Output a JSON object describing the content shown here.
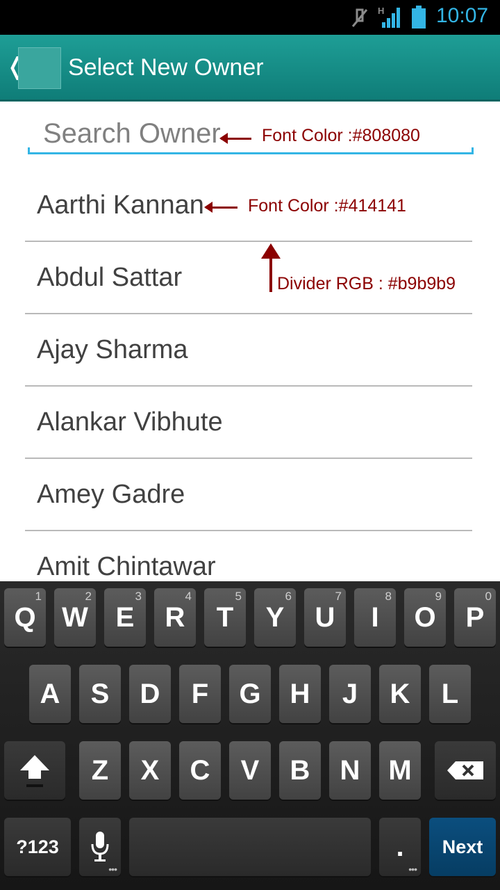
{
  "status_bar": {
    "time": "10:07",
    "network_type": "H"
  },
  "action_bar": {
    "title": "Select New Owner",
    "back_glyph": "❬"
  },
  "search": {
    "placeholder": "Search Owner",
    "value": ""
  },
  "owners": [
    "Aarthi Kannan",
    "Abdul Sattar",
    "Ajay Sharma",
    "Alankar Vibhute",
    "Amey Gadre",
    "Amit Chintawar"
  ],
  "annotations": {
    "search_font": "Font Color :#808080",
    "item_font": "Font Color :#414141",
    "divider": "Divider RGB : #b9b9b9"
  },
  "colors": {
    "action_bar": "#1e9e96",
    "search_underline": "#33b5e5",
    "placeholder": "#808080",
    "item_text": "#414141",
    "divider": "#b9b9b9",
    "annotation": "#8b0000",
    "next_key": "#0b4e7e"
  },
  "keyboard": {
    "row1": [
      {
        "label": "Q",
        "hint": "1"
      },
      {
        "label": "W",
        "hint": "2"
      },
      {
        "label": "E",
        "hint": "3"
      },
      {
        "label": "R",
        "hint": "4"
      },
      {
        "label": "T",
        "hint": "5"
      },
      {
        "label": "Y",
        "hint": "6"
      },
      {
        "label": "U",
        "hint": "7"
      },
      {
        "label": "I",
        "hint": "8"
      },
      {
        "label": "O",
        "hint": "9"
      },
      {
        "label": "P",
        "hint": "0"
      }
    ],
    "row2": [
      "A",
      "S",
      "D",
      "F",
      "G",
      "H",
      "J",
      "K",
      "L"
    ],
    "row3": [
      "Z",
      "X",
      "C",
      "V",
      "B",
      "N",
      "M"
    ],
    "symbols_label": "?123",
    "period_label": ".",
    "next_label": "Next",
    "shift_icon": "shift-icon",
    "backspace_icon": "backspace-icon",
    "mic_icon": "microphone-icon"
  }
}
